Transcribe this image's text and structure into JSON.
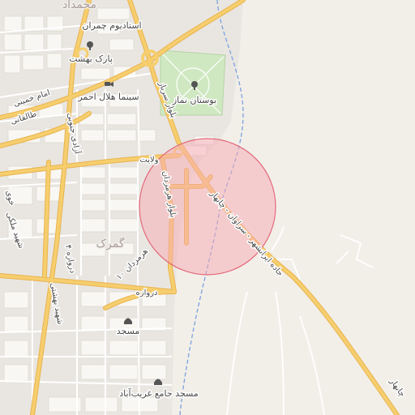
{
  "map": {
    "colors": {
      "land": "#f2efe9",
      "urban": "#e9e6e1",
      "block": "#f8f7f3",
      "park": "#cfe8c1",
      "major_road": "#f6ce6e",
      "major_road_casing": "#e8b34f",
      "minor_road": "#ffffff",
      "river": "#7aa0e0",
      "radius_fill": "#f7aab3",
      "radius_stroke": "#e36a7a"
    },
    "labels": {
      "district_north": "محمداد",
      "stadium": "استادیوم چمران",
      "park_behesht": "پارک بهشت",
      "imam_khomeini": "امام خمینی",
      "cinema": "سینما هلال احمر",
      "park_namaz": "بوستان نماز",
      "blvd_sarbaz": "بلوار سرباز",
      "taleghani": "طالقانی",
      "azadi": "آزادی جنوبی",
      "velayat": "ولایت",
      "khoy": "خوی",
      "blvd_hormozdan": "بلوار هرمزدان",
      "customs": "گمرک",
      "shahid_maleki": "شهید ملکی",
      "hormozdan_10": "هرمزدان ۱۰",
      "dorazeh_4": "دروازه ۴",
      "dorazeh": "دروازه",
      "shahid_beheshti": "شهید بهشتی",
      "mosque": "مسجد",
      "mosque_gharib": "مسجد جامع غریب‌آباد",
      "road_iranshahr": "جاده ایرانشهر - سراوان - چابهار",
      "chabahar": "چابهار"
    },
    "icons": {
      "stadium": "tree-icon",
      "park_behesht": "tree-icon",
      "cinema": "cinema-icon",
      "park_namaz": "tree-icon",
      "mosque": "mosque-icon",
      "mosque_gharib": "mosque-icon"
    },
    "radius_circle": "highlight-radius"
  }
}
